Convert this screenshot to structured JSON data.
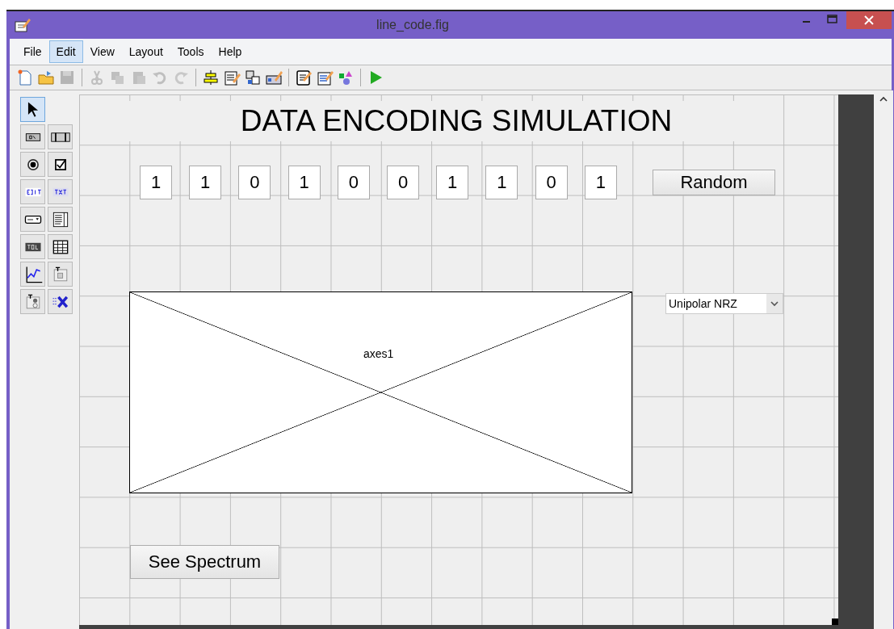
{
  "window": {
    "title": "line_code.fig"
  },
  "menu": [
    {
      "label": "File",
      "selected": false
    },
    {
      "label": "Edit",
      "selected": true
    },
    {
      "label": "View",
      "selected": false
    },
    {
      "label": "Layout",
      "selected": false
    },
    {
      "label": "Tools",
      "selected": false
    },
    {
      "label": "Help",
      "selected": false
    }
  ],
  "toolbar": [
    [
      {
        "kind": "new",
        "disabled": false
      },
      {
        "kind": "open",
        "disabled": false
      },
      {
        "kind": "save",
        "disabled": true
      }
    ],
    [
      {
        "kind": "cut",
        "disabled": true
      },
      {
        "kind": "copy",
        "disabled": true
      },
      {
        "kind": "paste",
        "disabled": true
      },
      {
        "kind": "undo",
        "disabled": true
      },
      {
        "kind": "redo",
        "disabled": true
      }
    ],
    [
      {
        "kind": "align",
        "disabled": false
      },
      {
        "kind": "menu-editor",
        "disabled": false
      },
      {
        "kind": "tab-order",
        "disabled": false
      },
      {
        "kind": "toolbar-editor",
        "disabled": false
      }
    ],
    [
      {
        "kind": "editor",
        "disabled": false
      },
      {
        "kind": "inspector",
        "disabled": false
      },
      {
        "kind": "browser",
        "disabled": false
      }
    ],
    [
      {
        "kind": "run",
        "disabled": false
      }
    ]
  ],
  "palette": [
    {
      "kind": "select",
      "selected": true
    },
    {
      "kind": "pushbutton",
      "selected": false
    },
    {
      "kind": "slider",
      "selected": false
    },
    {
      "kind": "radio",
      "selected": false
    },
    {
      "kind": "checkbox",
      "selected": false
    },
    {
      "kind": "edit",
      "selected": false
    },
    {
      "kind": "text",
      "selected": false
    },
    {
      "kind": "popup",
      "selected": false
    },
    {
      "kind": "listbox",
      "selected": false
    },
    {
      "kind": "toggle",
      "selected": false
    },
    {
      "kind": "table",
      "selected": false
    },
    {
      "kind": "axes",
      "selected": false
    },
    {
      "kind": "panel",
      "selected": false
    },
    {
      "kind": "buttongroup",
      "selected": false
    },
    {
      "kind": "activex",
      "selected": false
    }
  ],
  "canvas": {
    "heading": "DATA ENCODING SIMULATION",
    "bits": [
      "1",
      "1",
      "0",
      "1",
      "0",
      "0",
      "1",
      "1",
      "0",
      "1"
    ],
    "random_button": "Random",
    "axes": {
      "label": "axes1"
    },
    "popup": {
      "value": "Unipolar NRZ"
    },
    "spectrum_button": "See Spectrum"
  }
}
